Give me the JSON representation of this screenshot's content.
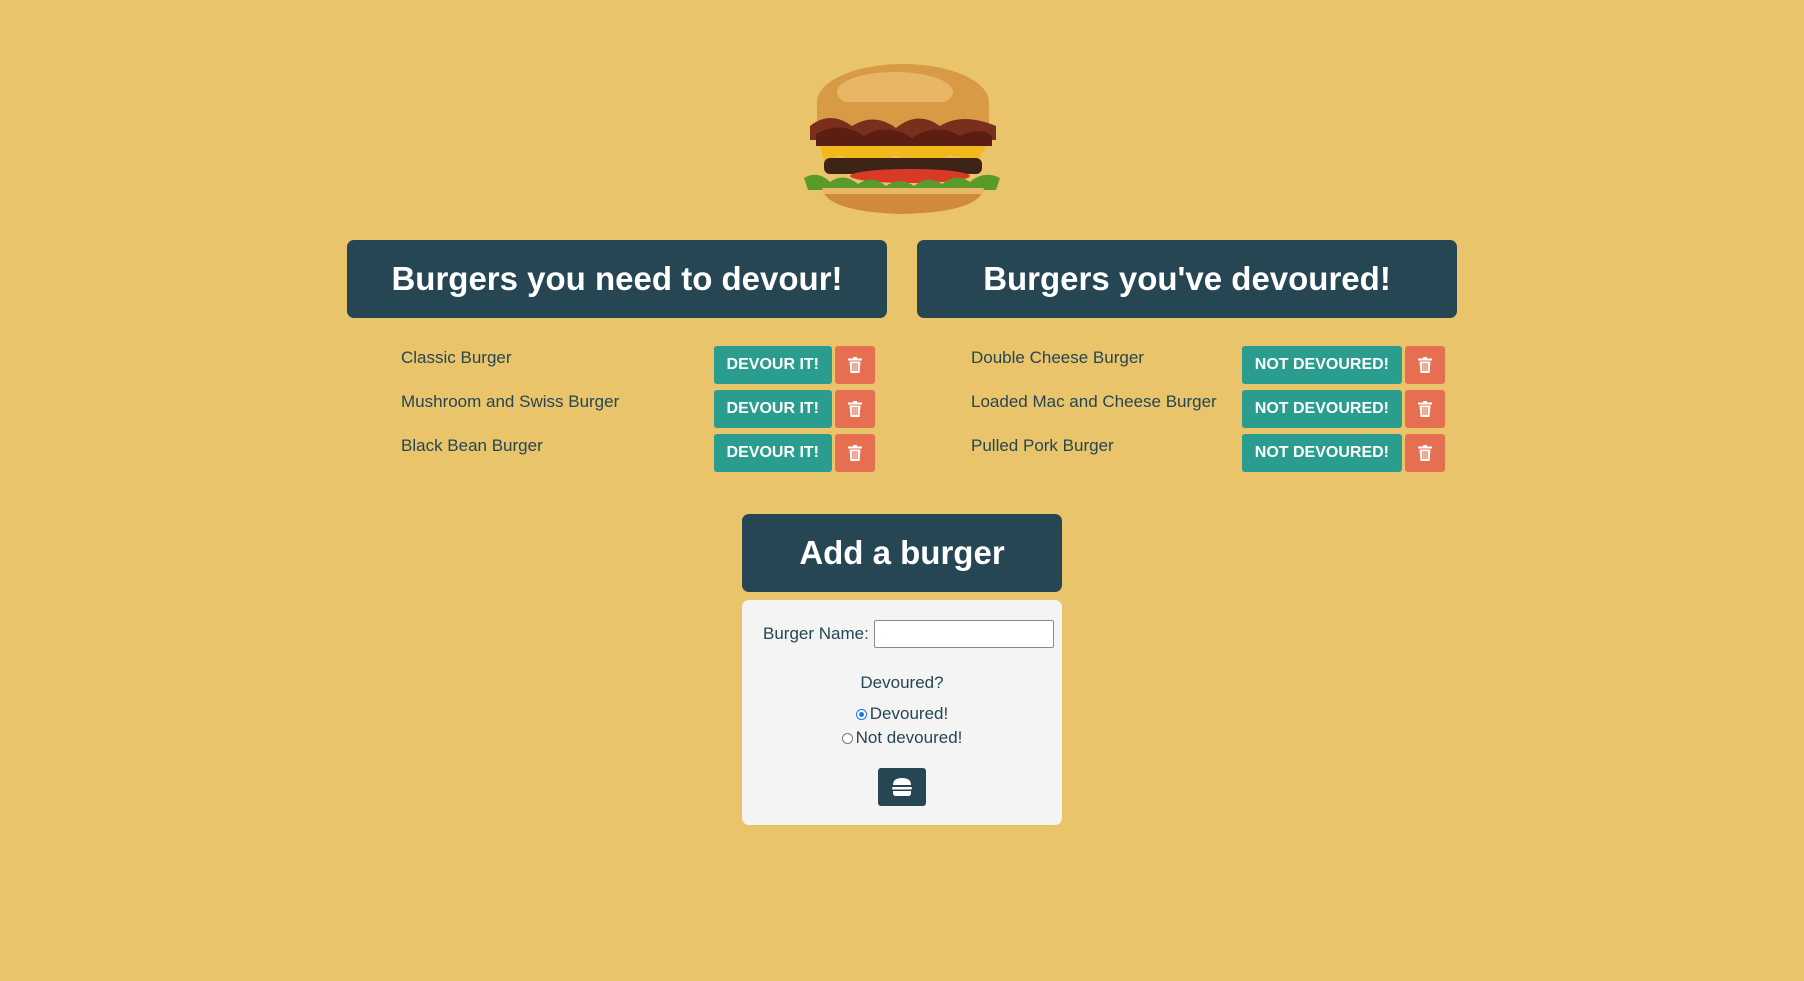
{
  "colors": {
    "background": "#e9c46a",
    "header": "#264653",
    "teal_button": "#2a9d8f",
    "delete_button": "#e76f51",
    "form_panel": "#f4f4f4"
  },
  "hero": {
    "icon": "burger-image"
  },
  "to_devour": {
    "title": "Burgers you need to devour!",
    "button_label": "DEVOUR IT!",
    "items": [
      {
        "name": "Classic Burger"
      },
      {
        "name": "Mushroom and Swiss Burger"
      },
      {
        "name": "Black Bean Burger"
      }
    ]
  },
  "devoured": {
    "title": "Burgers you've devoured!",
    "button_label": "NOT DEVOURED!",
    "items": [
      {
        "name": "Double Cheese Burger"
      },
      {
        "name": "Loaded Mac and Cheese Burger"
      },
      {
        "name": "Pulled Pork Burger"
      }
    ]
  },
  "add_form": {
    "title": "Add a burger",
    "name_label": "Burger Name:",
    "name_value": "",
    "question": "Devoured?",
    "options": [
      {
        "label": "Devoured!",
        "checked": true
      },
      {
        "label": "Not devoured!",
        "checked": false
      }
    ],
    "submit_icon": "hamburger-icon"
  }
}
